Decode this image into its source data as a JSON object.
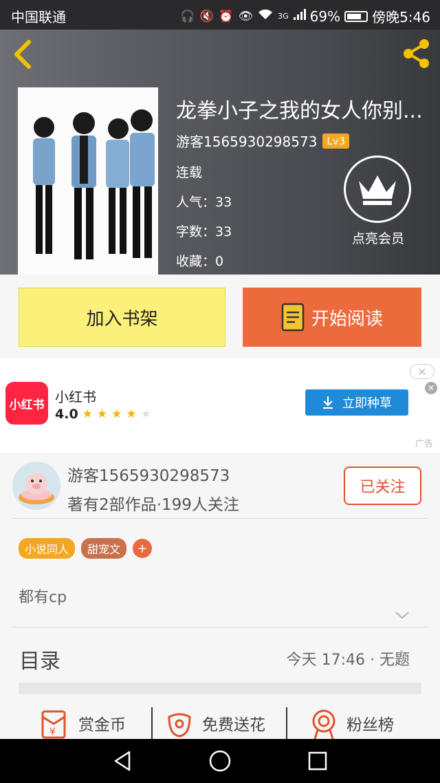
{
  "status_bar": {
    "carrier": "中国联通",
    "network": "3G",
    "battery": "69%",
    "time": "傍晚5:46"
  },
  "book": {
    "title": "龙拳小子之我的女人你别...",
    "author": "游客1565930298573",
    "level": "Lv3",
    "status": "连载",
    "popularity": "人气：33",
    "word_count": "字数：33",
    "favorites": "收藏：0",
    "vip_label": "点亮会员"
  },
  "actions": {
    "add_shelf": "加入书架",
    "start_read": "开始阅读"
  },
  "ad": {
    "app_name": "小红书",
    "logo_text": "小红书",
    "rating": "4.0",
    "stars": 4,
    "cta": "立即种草",
    "label": "广告"
  },
  "author_info": {
    "name": "游客1565930298573",
    "stats": "著有2部作品·199人关注",
    "follow_label": "已关注",
    "tags": [
      {
        "label": "小说同人",
        "color": "#f5a623"
      },
      {
        "label": "甜宠文",
        "color": "#c9704d"
      }
    ],
    "tag_add": "+",
    "description": "都有cp"
  },
  "toc": {
    "label": "目录",
    "latest": "今天 17:46 · 无题"
  },
  "tools": {
    "reward": "赏金币",
    "flower": "免费送花",
    "fans": "粉丝榜"
  },
  "colors": {
    "accent_orange": "#ec6b3d",
    "shelf_yellow": "#fbf07a",
    "ad_blue": "#1f8bd8",
    "icon_yellow": "#f2c200"
  }
}
